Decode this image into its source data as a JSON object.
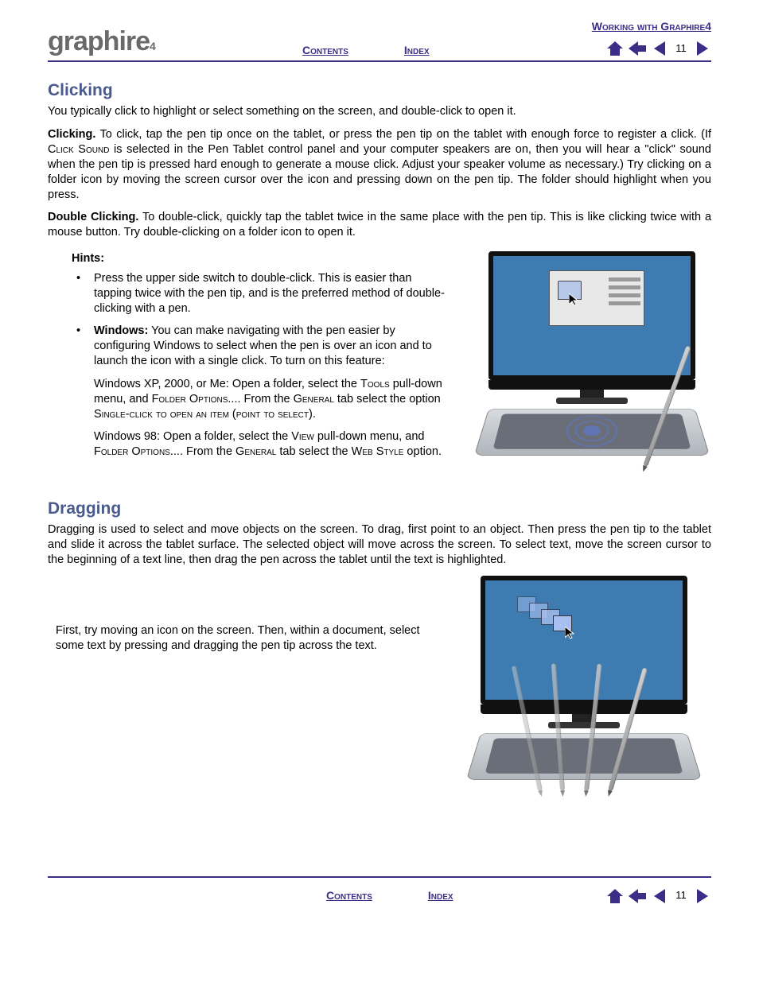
{
  "brand": {
    "name": "graphire",
    "suffix": "4"
  },
  "header": {
    "chapter": "Working with Graphire4",
    "contents": "Contents",
    "index": "Index",
    "page": "11"
  },
  "section1": {
    "title": "Clicking",
    "intro": "You typically click to highlight or select something on the screen, and double-click to open it.",
    "clicking_label": "Clicking.",
    "clicking_body_1": " To click, tap the pen tip once on the tablet, or press the pen tip on the tablet with enough force to register a click.  (If  ",
    "click_sound_sc": "Click Sound",
    "clicking_body_2": " is selected in the Pen Tablet control panel and your computer speakers are on, then you will hear a \"click\" sound when the pen tip is pressed hard enough to generate a mouse click.  Adjust your speaker volume as necessary.)  Try clicking on a folder icon by moving the screen cursor over the icon and pressing down on the pen tip.  The folder should highlight when you press.",
    "dbl_label": "Double Clicking.",
    "dbl_body": "  To double-click, quickly tap the tablet twice in the same place with the pen tip.  This is like clicking twice with a mouse button.  Try double-clicking on a folder icon to open it.",
    "hints_label": "Hints:",
    "hint1": "Press the upper side switch to double-click.  This is easier than tapping twice with the pen tip, and is the preferred method of double-clicking with a pen.",
    "hint2_label": "Windows:",
    "hint2_body": " You can make navigating with the pen easier by configuring Windows to select when the pen is over an icon and to launch the icon with a single click.  To turn on this feature:",
    "hint2_p1_a": "Windows XP, 2000, or Me: Open a folder, select the ",
    "hint2_p1_tools": "Tools",
    "hint2_p1_b": " pull-down menu, and ",
    "hint2_p1_folder": "Folder Options...",
    "hint2_p1_c": ".  From the ",
    "hint2_p1_gen": "General",
    "hint2_p1_d": " tab select the option ",
    "hint2_p1_single": "Single-click to open an item (point to select)",
    "hint2_p1_e": ".",
    "hint2_p2_a": "Windows 98: Open a folder, select the ",
    "hint2_p2_view": "View",
    "hint2_p2_b": " pull-down menu, and ",
    "hint2_p2_folder": "Folder Options...",
    "hint2_p2_c": ".  From the ",
    "hint2_p2_gen": "General",
    "hint2_p2_d": " tab select the ",
    "hint2_p2_web": "Web Style",
    "hint2_p2_e": " option."
  },
  "section2": {
    "title": "Dragging",
    "intro": "Dragging is used to select and move objects on the screen.  To drag, first point to an object.  Then press the pen tip to the tablet and slide it across the tablet surface.  The selected object will move across the screen.  To select text, move the screen cursor to the beginning of a text line, then drag the pen across the tablet until the text is highlighted.",
    "aside": "First, try moving an icon on the screen.  Then, within a document, select some text by pressing and dragging the pen tip across the text."
  },
  "footer": {
    "contents": "Contents",
    "index": "Index",
    "page": "11"
  }
}
